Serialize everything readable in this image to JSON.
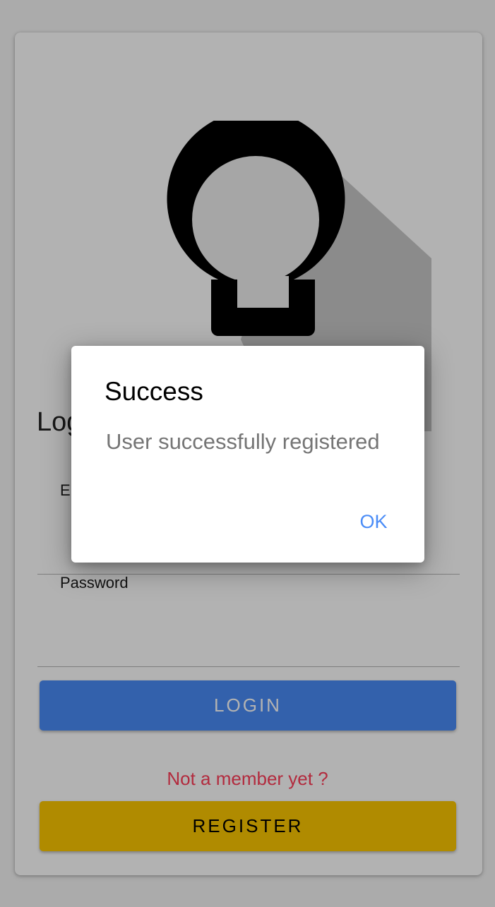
{
  "login": {
    "heading": "Login",
    "email_label": "Email",
    "password_label": "Password",
    "login_button": "LOGIN",
    "register_prompt": "Not a member yet ?",
    "register_button": "REGISTER"
  },
  "dialog": {
    "title": "Success",
    "message": "User successfully registered",
    "ok_button": "OK"
  },
  "icons": {
    "logo": "lightbulb-icon"
  },
  "colors": {
    "primary": "#4a8cf7",
    "register": "#fcc700",
    "register_prompt": "#ff3e59",
    "dialog_text": "#757575"
  }
}
